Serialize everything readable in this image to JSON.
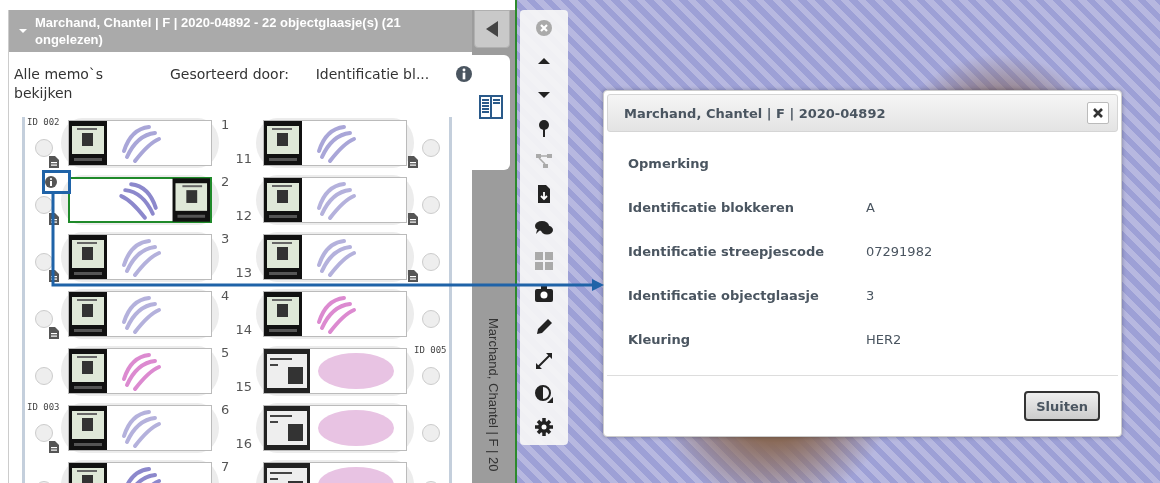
{
  "case_panel": {
    "title": "Marchand, Chantel | F | 2020-04892 - 22 objectglaasje(s) (21 ongelezen)",
    "expanded": true,
    "memo_link": "Alle memo`s bekijken",
    "sort_label": "Gesorteerd door:",
    "sort_value": "Identificatie bl...",
    "rows": [
      {
        "left": {
          "group_label": "ID 002",
          "number": "1",
          "color": "#a9a6d8",
          "kind": "dark-label",
          "flipped": false,
          "selected": false,
          "checked": false,
          "memo": true,
          "info": false
        },
        "right": {
          "number": "11",
          "color": "#a9a6d8",
          "kind": "dark-label",
          "flipped": false,
          "selected": false,
          "checked": false,
          "memo": true,
          "info": false
        }
      },
      {
        "left": {
          "number": "2",
          "color": "#8c88cc",
          "kind": "dark-label",
          "flipped": true,
          "selected": true,
          "checked": false,
          "memo": true,
          "info": true
        },
        "right": {
          "number": "12",
          "color": "#b4b1dc",
          "kind": "dark-label",
          "flipped": false,
          "selected": false,
          "checked": false,
          "memo": true,
          "info": false
        }
      },
      {
        "left": {
          "number": "3",
          "color": "#b4b1dc",
          "kind": "dark-label",
          "flipped": false,
          "selected": false,
          "checked": false,
          "memo": true,
          "info": false
        },
        "right": {
          "number": "13",
          "color": "#b4b1dc",
          "kind": "dark-label",
          "flipped": false,
          "selected": false,
          "checked": false,
          "memo": true,
          "info": false
        }
      },
      {
        "left": {
          "number": "4",
          "color": "#b4b1dc",
          "kind": "dark-label",
          "flipped": false,
          "selected": false,
          "checked": false,
          "memo": true,
          "info": false
        },
        "right": {
          "number": "14",
          "color": "#dc8ad0",
          "kind": "dark-label",
          "flipped": false,
          "selected": false,
          "checked": false,
          "memo": false,
          "info": false
        }
      },
      {
        "left": {
          "number": "5",
          "color": "#dc8ad0",
          "kind": "dark-label",
          "flipped": false,
          "selected": false,
          "checked": false,
          "memo": false,
          "info": false
        },
        "right": {
          "group_label": "ID 005",
          "number": "15",
          "color": "#e8c3e3",
          "kind": "light-label",
          "flipped": false,
          "selected": false,
          "checked": false,
          "memo": false,
          "info": false
        }
      },
      {
        "left": {
          "group_label": "ID 003",
          "number": "6",
          "color": "#b4b1dc",
          "kind": "dark-label",
          "flipped": false,
          "selected": false,
          "checked": false,
          "memo": true,
          "info": false
        },
        "right": {
          "number": "16",
          "color": "#e8c3e3",
          "kind": "light-label",
          "flipped": false,
          "selected": false,
          "checked": false,
          "memo": false,
          "info": false
        }
      },
      {
        "left": {
          "number": "7",
          "color": "#8c88cc",
          "kind": "dark-label",
          "flipped": false,
          "selected": false,
          "checked": false,
          "memo": false,
          "info": false
        },
        "right": {
          "color": "#e8c3e3",
          "kind": "light-label",
          "flipped": false,
          "selected": false,
          "checked": false,
          "memo": false,
          "info": false
        }
      }
    ]
  },
  "side_strip": {
    "vertical_title": "Marchand, Chantel | F | 20"
  },
  "toolbar": [
    {
      "kind": "close",
      "disabled": true
    },
    {
      "kind": "up",
      "disabled": false
    },
    {
      "kind": "down",
      "disabled": false
    },
    {
      "kind": "pin",
      "disabled": false
    },
    {
      "kind": "tree",
      "disabled": true
    },
    {
      "kind": "download",
      "disabled": false
    },
    {
      "kind": "chat",
      "disabled": false
    },
    {
      "kind": "grid",
      "disabled": true
    },
    {
      "kind": "camera",
      "disabled": false
    },
    {
      "kind": "pencil",
      "disabled": false
    },
    {
      "kind": "expand",
      "disabled": false
    },
    {
      "kind": "contrast",
      "disabled": false
    },
    {
      "kind": "gear",
      "disabled": false
    }
  ],
  "dialog": {
    "title": "Marchand, Chantel | F | 2020-04892",
    "fields": [
      {
        "label": "Opmerking"
      },
      {
        "label": "Identificatie blokkeren",
        "value": "A"
      },
      {
        "label": "Identificatie streepjescode",
        "value": "07291982"
      },
      {
        "label": "Identificatie objectglaasje",
        "value": "3"
      },
      {
        "label": "Kleuring",
        "value": "HER2"
      }
    ],
    "button": "Sluiten"
  }
}
